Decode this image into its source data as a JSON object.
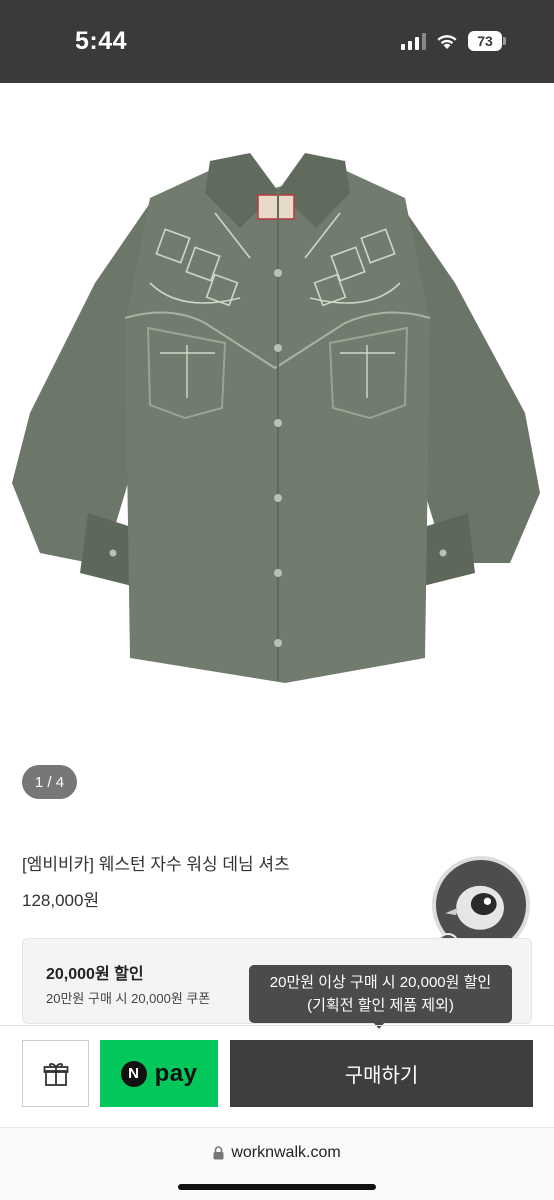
{
  "status_bar": {
    "time": "5:44",
    "battery": "73",
    "icons": [
      "signal-icon",
      "wifi-icon",
      "battery-icon"
    ]
  },
  "product": {
    "image_counter": "1 / 4",
    "name": "[엠비비카] 웨스턴 자수 워싱 데님 셔츠",
    "price": "128,000원"
  },
  "coupon": {
    "title": "20,000원 할인",
    "description": "20만원 구매 시 20,000원 쿠폰"
  },
  "tooltip": {
    "line1": "20만원 이상 구매 시 20,000원 할인",
    "line2": "(기획전 할인 제품 제외)"
  },
  "actions": {
    "gift_icon": "gift-icon",
    "npay_n": "N",
    "npay_label": "pay",
    "buy_label": "구매하기"
  },
  "browser": {
    "url": "worknwalk.com"
  },
  "colors": {
    "status_bar_bg": "#3a3a3a",
    "npay_green": "#03c75a",
    "buy_button_bg": "#3e3e3e",
    "tooltip_bg": "#4b4b4b",
    "shirt_denim": "#6f7a6c"
  }
}
